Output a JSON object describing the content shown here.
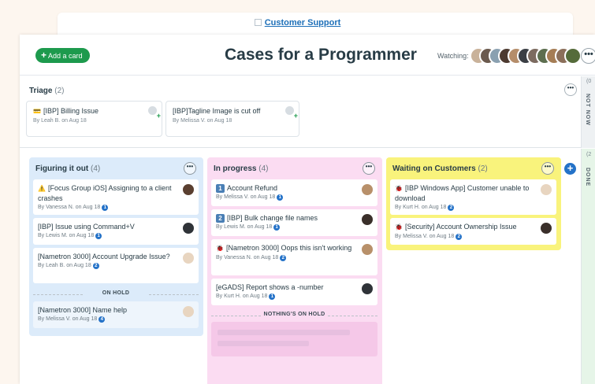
{
  "breadcrumb": {
    "label": "Customer Support"
  },
  "header": {
    "add_label": "Add a card",
    "title": "Cases for a Programmer",
    "watching_label": "Watching:"
  },
  "triage": {
    "label": "Triage",
    "count": "(2)",
    "cards": [
      {
        "title": "[IBP] Billing Issue",
        "meta": "By Leah B. on Aug 18"
      },
      {
        "title": "[IBP]Tagline Image is cut off",
        "meta": "By Melissa V. on Aug 18"
      }
    ]
  },
  "rail": {
    "top_count": "(0",
    "top_label": "NOT NOW",
    "bottom_count": "(2",
    "bottom_label": "DONE"
  },
  "columns": [
    {
      "name": "Figuring it out",
      "count": "(4)",
      "cards": [
        {
          "icon": "⚠️",
          "title": "[Focus Group iOS] Assigning to a client crashes",
          "meta": "By Vanessa N. on Aug 18",
          "badge": "1"
        },
        {
          "title": "[IBP] Issue using Command+V",
          "meta": "By Lewis M. on Aug 18",
          "badge": "1"
        },
        {
          "title": "[Nametron 3000] Account Upgrade Issue?",
          "meta": "By Leah B. on Aug 18",
          "badge": "2"
        }
      ],
      "divider": "ON HOLD",
      "hold_cards": [
        {
          "title": "[Nametron 3000] Name help",
          "meta": "By Melissa V. on Aug 18",
          "badge": "4"
        }
      ]
    },
    {
      "name": "In progress",
      "count": "(4)",
      "cards": [
        {
          "num": "1",
          "title": "Account Refund",
          "meta": "By Melissa V. on Aug 18",
          "badge": "1"
        },
        {
          "num": "2",
          "title": "[IBP] Bulk change file names",
          "meta": "By Lewis M. on Aug 18",
          "badge": "1"
        },
        {
          "icon": "🐞",
          "title": "[Nametron 3000] Oops this isn't working",
          "meta": "By Vanessa N. on Aug 18",
          "badge": "2"
        },
        {
          "title": "[eGADS] Report shows a -number",
          "meta": "By Kurt H. on Aug 18",
          "badge": "1"
        }
      ],
      "divider": "NOTHING'S ON HOLD"
    },
    {
      "name": "Waiting on Customers",
      "count": "(2)",
      "cards": [
        {
          "icon": "🐞",
          "title": "[IBP Windows App] Customer unable to download",
          "meta": "By Kurt H. on Aug 18",
          "badge": "2"
        },
        {
          "icon": "🐞",
          "title": "[Security] Account Ownership Issue",
          "meta": "By Melissa V. on Aug 18",
          "badge": "2"
        }
      ]
    }
  ],
  "colors": {
    "col1": "#dcebfa",
    "col2": "#fbdcf2",
    "col3": "#f9f37c",
    "accent": "#1d9a4d",
    "link": "#1d6fb8"
  }
}
